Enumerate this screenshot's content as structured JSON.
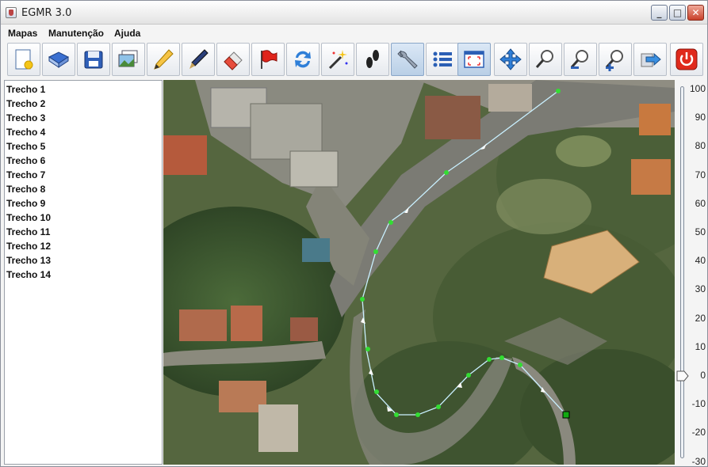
{
  "window": {
    "title": "EGMR 3.0",
    "minimize": "_",
    "maximize": "□",
    "close": "✕"
  },
  "menu": [
    "Mapas",
    "Manutenção",
    "Ajuda"
  ],
  "toolbar": {
    "buttons": [
      {
        "name": "new-map-icon"
      },
      {
        "name": "open-book-icon"
      },
      {
        "name": "save-disk-icon"
      },
      {
        "name": "images-icon"
      },
      {
        "name": "pencil-icon"
      },
      {
        "name": "pen-icon"
      },
      {
        "name": "eraser-icon"
      },
      {
        "name": "flag-icon"
      },
      {
        "name": "refresh-arrows-icon"
      },
      {
        "name": "magic-wand-icon"
      },
      {
        "name": "footprints-icon"
      },
      {
        "name": "wrench-icon",
        "active": true
      },
      {
        "name": "list-icon"
      },
      {
        "name": "fit-window-icon",
        "active": true
      },
      {
        "name": "move-arrows-icon"
      },
      {
        "name": "zoom-icon"
      },
      {
        "name": "zoom-out-icon"
      },
      {
        "name": "zoom-in-icon"
      },
      {
        "name": "export-arrow-icon"
      },
      {
        "name": "power-icon"
      }
    ]
  },
  "trechos": [
    "Trecho 1",
    "Trecho 2",
    "Trecho 3",
    "Trecho 4",
    "Trecho 5",
    "Trecho 6",
    "Trecho 7",
    "Trecho 8",
    "Trecho 9",
    "Trecho 10",
    "Trecho 11",
    "Trecho 12",
    "Trecho 13",
    "Trecho 14"
  ],
  "zoom": {
    "labels": [
      "100",
      "90",
      "80",
      "70",
      "60",
      "50",
      "40",
      "30",
      "20",
      "10",
      "0",
      "-10",
      "-20",
      "-30"
    ],
    "value": 0
  },
  "colors": {
    "route_line": "#c9f0ff",
    "route_point": "#33dd33",
    "route_end": "#11aa11"
  }
}
